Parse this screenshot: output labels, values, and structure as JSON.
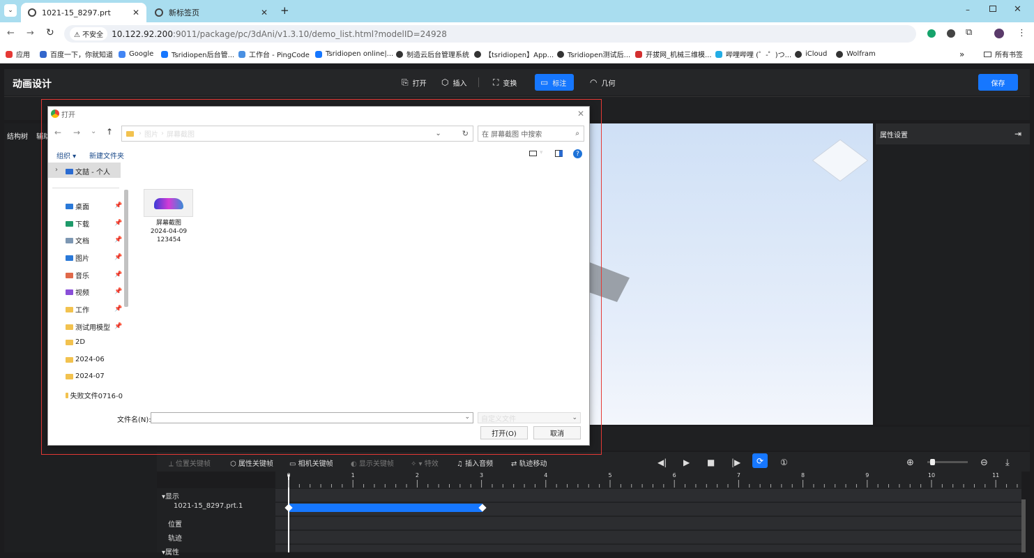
{
  "browser": {
    "tabs": [
      {
        "label": "1021-15_8297.prt"
      },
      {
        "label": "新标签页"
      }
    ],
    "address": {
      "insecure": "不安全",
      "host": "10.122.92.200",
      "path": ":9011/package/pc/3dAni/v1.3.10/demo_list.html?modelID=24928"
    },
    "bookmarks": [
      {
        "label": "应用",
        "color": "#e53935"
      },
      {
        "label": "百度一下，你就知道",
        "color": "#3366cc"
      },
      {
        "label": "Google",
        "color": "#4285f4"
      },
      {
        "label": "Tsridiopen后台管...",
        "color": "#1677ff"
      },
      {
        "label": "工作台 - PingCode",
        "color": "#4a90e2"
      },
      {
        "label": "Tsridiopen online|...",
        "color": "#1677ff"
      },
      {
        "label": "制造云后台管理系统",
        "color": "#333"
      },
      {
        "label": "【tsridiopen】App...",
        "color": "#333"
      },
      {
        "label": "Tsridiopen测试后...",
        "color": "#333"
      },
      {
        "label": "开拔网_机械三维模...",
        "color": "#d32f2f"
      },
      {
        "label": "哔哩哔哩 (゜-゜)つ...",
        "color": "#23ade5"
      },
      {
        "label": "iCloud",
        "color": "#333"
      },
      {
        "label": "Wolfram",
        "color": "#333"
      }
    ],
    "all_bookmarks": "所有书签"
  },
  "app": {
    "title": "动画设计",
    "toolbar": {
      "open": "打开",
      "insert": "插入",
      "transform": "变换",
      "annotate": "标注",
      "geometry": "几何",
      "save": "保存"
    },
    "left_tabs": {
      "tree": "结构树",
      "aux": "辅助"
    },
    "right_panel": {
      "title": "属性设置"
    },
    "timeline": {
      "tools": [
        "位置关键帧",
        "属性关键帧",
        "相机关键帧",
        "显示关键帧",
        "特效",
        "插入音频",
        "轨迹移动"
      ],
      "ticks": [
        "0",
        "1",
        "2",
        "3",
        "4",
        "5",
        "6",
        "7",
        "8",
        "9",
        "10",
        "11"
      ],
      "groups": {
        "display": "▾显示",
        "attr": "▾属性"
      },
      "tracks": {
        "part": "1021-15_8297.prt.1",
        "position": "位置",
        "trajectory": "轨迹"
      }
    }
  },
  "dialog": {
    "title": "打开",
    "breadcrumb": [
      "图片",
      "屏幕截图"
    ],
    "search_placeholder": "在 屏幕截图 中搜索",
    "organize": "组织 ▾",
    "new_folder": "新建文件夹",
    "nav_root": "文喆 - 个人",
    "nav_items": [
      "桌面",
      "下载",
      "文档",
      "图片",
      "音乐",
      "视频",
      "工作",
      "测试用模型",
      "2D",
      "2024-06",
      "2024-07",
      "失败文件0716-0"
    ],
    "file": {
      "line1": "屏幕截图",
      "line2": "2024-04-09",
      "line3": "123454"
    },
    "filename_label": "文件名(N):",
    "filetype": "自定义文件",
    "open_button": "打开(O)",
    "cancel_button": "取消"
  }
}
